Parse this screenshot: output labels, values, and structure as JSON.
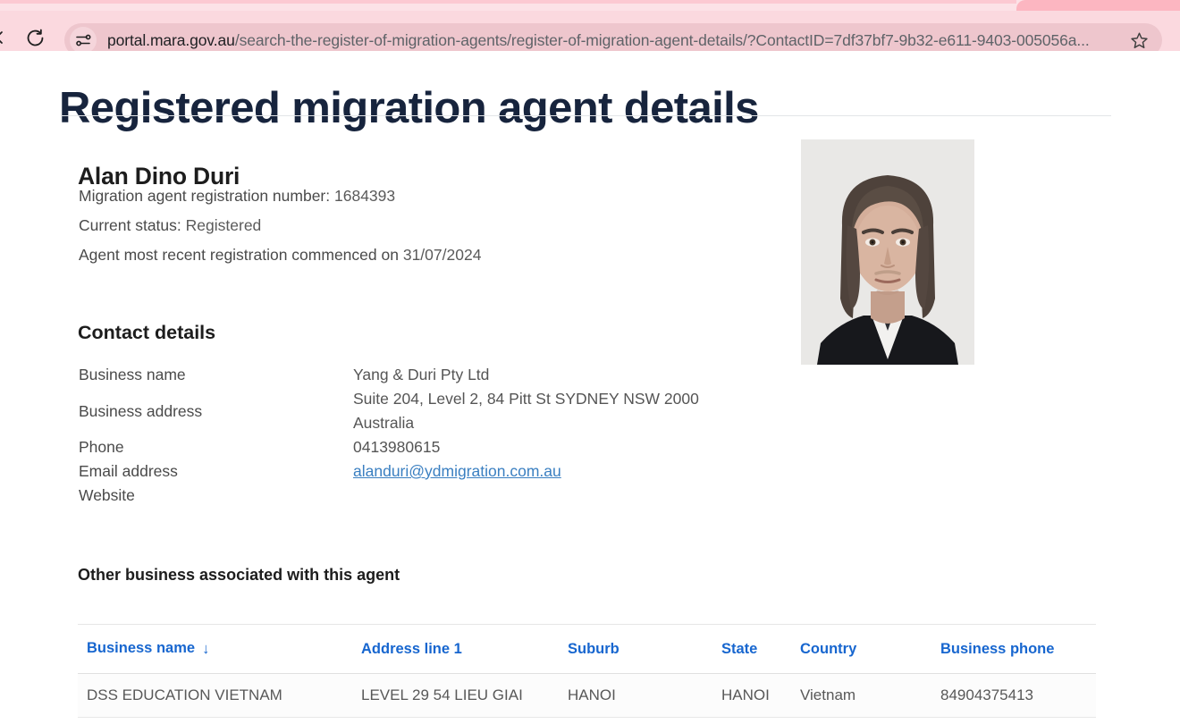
{
  "browser": {
    "reload_icon": "reload-icon",
    "site_settings_icon": "site-settings-tune-icon",
    "bookmark_icon": "star-outline-icon",
    "url_host": "portal.mara.gov.au",
    "url_path": "/search-the-register-of-migration-agents/register-of-migration-agent-details/?ContactID=7df37bf7-9b32-e611-9403-005056a...",
    "url_full": "portal.mara.gov.au/search-the-register-of-migration-agents/register-of-migration-agent-details/?ContactID=7df37bf7-9b32-e611-9403-005056a..."
  },
  "page": {
    "title": "Registered migration agent details",
    "agent_name": "Alan Dino Duri",
    "registration_number_label": "Migration agent registration number:",
    "registration_number": "1684393",
    "current_status_label": "Current status:",
    "current_status": "Registered",
    "commenced_label": "Agent most recent registration commenced on",
    "commenced_date": "31/07/2024",
    "photo_alt": "agent-portrait-photo"
  },
  "contact_details": {
    "heading": "Contact details",
    "business_name_label": "Business name",
    "business_name": "Yang & Duri Pty Ltd",
    "business_address_label": "Business address",
    "business_address_line1": "Suite 204, Level 2, 84 Pitt St SYDNEY NSW 2000",
    "business_address_line2": "Australia",
    "phone_label": "Phone",
    "phone": "0413980615",
    "email_label": "Email address",
    "email": "alanduri@ydmigration.com.au",
    "website_label": "Website",
    "website": ""
  },
  "other_business": {
    "heading": "Other business associated with this agent",
    "sort_arrow": "↓",
    "columns": [
      "Business name",
      "Address line 1",
      "Suburb",
      "State",
      "Country",
      "Business phone"
    ],
    "rows": [
      {
        "business_name": "DSS EDUCATION VIETNAM",
        "address_line_1": "LEVEL 29 54 LIEU GIAI",
        "suburb": "HANOI",
        "state": "HANOI",
        "country": "Vietnam",
        "business_phone": "84904375413"
      }
    ]
  },
  "colors": {
    "chrome_pink": "#fbd9df",
    "title_navy": "#17243d",
    "link_blue": "#3a7fc1",
    "table_header_blue": "#1766cf"
  }
}
